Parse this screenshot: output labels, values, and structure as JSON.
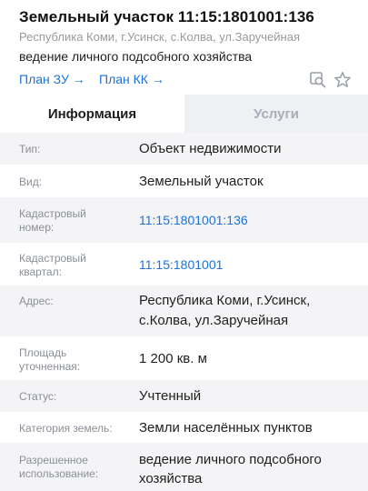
{
  "header": {
    "title": "Земельный участок 11:15:1801001:136",
    "address": "Республика Коми, г.Усинск, с.Колва, ул.Заручейная",
    "usage": "ведение личного подсобного хозяйства",
    "plan_zu_label": "План ЗУ →",
    "plan_kk_label": "План КК →"
  },
  "tabs": [
    {
      "label": "Информация",
      "active": true
    },
    {
      "label": "Услуги",
      "active": false
    }
  ],
  "rows": [
    {
      "label": "Тип:",
      "value": "Объект недвижимости"
    },
    {
      "label": "Вид:",
      "value": "Земельный участок"
    },
    {
      "label_line1": "Кадастровый",
      "label_line2": "номер:",
      "value": "11:15:1801001:136"
    },
    {
      "label_line1": "Кадастровый",
      "label_line2": "квартал:",
      "value": "11:15:1801001"
    },
    {
      "label": "Адрес:",
      "value_line1": "Республика Коми, г.Усинск,",
      "value_line2": "с.Колва, ул.Заручейная"
    },
    {
      "label_line1": "Площадь",
      "label_line2": "уточненная:",
      "value": "1 200 кв. м"
    },
    {
      "label": "Статус:",
      "value": "Учтенный"
    },
    {
      "label": "Категория земель:",
      "value": "Земли населённых пунктов"
    },
    {
      "label_line1": "Разрешенное",
      "label_line2": "использование:",
      "value_line1": "ведение личного подсобного",
      "value_line2": "хозяйства"
    }
  ],
  "icons": {
    "search_map": "map-search-icon",
    "favorite": "star-icon"
  },
  "colors": {
    "link": "#1a73d9",
    "label": "#8a8f97",
    "row_alt_bg": "#f4f4f6",
    "inactive_tab_bg": "#eef0f4"
  }
}
